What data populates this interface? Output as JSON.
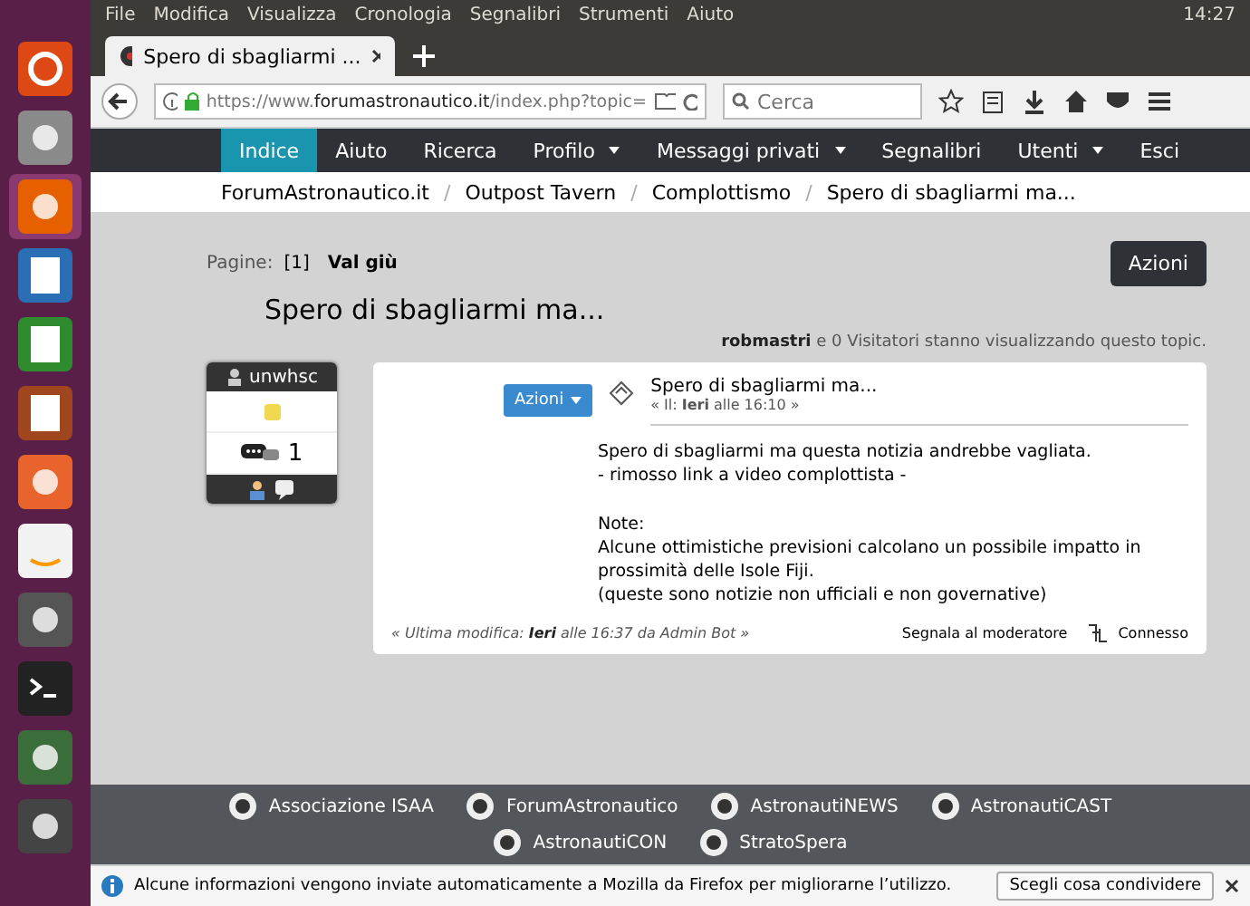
{
  "menu_bar": {
    "items": [
      "File",
      "Modifica",
      "Visualizza",
      "Cronologia",
      "Segnalibri",
      "Strumenti",
      "Aiuto"
    ],
    "clock": "14:27"
  },
  "launcher": {
    "items": [
      {
        "kind": "ubuntu",
        "selected": false
      },
      {
        "kind": "files",
        "selected": false
      },
      {
        "kind": "browser",
        "selected": true
      },
      {
        "kind": "writer",
        "selected": false
      },
      {
        "kind": "calc",
        "selected": false
      },
      {
        "kind": "impress",
        "selected": false
      },
      {
        "kind": "store",
        "selected": false
      },
      {
        "kind": "amazon",
        "selected": false
      },
      {
        "kind": "settings",
        "selected": false
      },
      {
        "kind": "terminal",
        "selected": false
      },
      {
        "kind": "updater",
        "selected": false
      },
      {
        "kind": "floppy",
        "selected": false
      }
    ]
  },
  "tab": {
    "title": "Spero di sbagliarmi ..."
  },
  "address_bar": {
    "url": "https://www.**forumastronautico.it**/index.php?topic="
  },
  "search": {
    "placeholder": "Cerca"
  },
  "forum_nav": [
    {
      "label": "Indice",
      "selected": true,
      "dropdown": false
    },
    {
      "label": "Aiuto",
      "selected": false,
      "dropdown": false
    },
    {
      "label": "Ricerca",
      "selected": false,
      "dropdown": false
    },
    {
      "label": "Profilo",
      "selected": false,
      "dropdown": true
    },
    {
      "label": "Messaggi privati",
      "selected": false,
      "dropdown": true
    },
    {
      "label": "Segnalibri",
      "selected": false,
      "dropdown": false
    },
    {
      "label": "Utenti",
      "selected": false,
      "dropdown": true
    },
    {
      "label": "Esci",
      "selected": false,
      "dropdown": false
    }
  ],
  "breadcrumb_separator": "/",
  "breadcrumbs": [
    "ForumAstronautico.it",
    "Outpost Tavern",
    "Complottismo",
    "Spero di sbagliarmi ma..."
  ],
  "pagination": {
    "label": "Pagine:",
    "current": "[1]",
    "jump": "Val giù"
  },
  "actions_button": "Azioni",
  "topic_title": "Spero di sbagliarmi ma...",
  "viewers": "**robmastri** e 0 Visitatori stanno visualizzando questo topic.",
  "post": {
    "author": {
      "name": "unwhsc",
      "posts": "1"
    },
    "actions_button": "Azioni",
    "title": "Spero di sbagliarmi ma...",
    "date": "« Il: **Ieri** alle 16:10 »",
    "body": [
      [
        "Spero di sbagliarmi ma questa notizia andrebbe vagliata.",
        "- rimosso link a video complottista -"
      ],
      [
        "Note:",
        "Alcune ottimistiche previsioni calcolano un possibile impatto in prossimità delle Isole Fiji.",
        "(queste sono notizie non ufficiali e non governative)"
      ]
    ],
    "edit_note": "« Ultima modifica: **Ieri** alle 16:37 da Admin Bot »",
    "report_link": "Segnala al moderatore",
    "status": "Connesso"
  },
  "footer_links": [
    "Associazione ISAA",
    "ForumAstronautico",
    "AstronautiNEWS",
    "AstronautiCAST",
    "AstronautiCON",
    "StratoSpera"
  ],
  "notification": {
    "text": "Alcune informazioni vengono inviate automaticamente a Mozilla da Firefox per migliorarne l’utilizzo.",
    "button": "Scegli cosa condividere"
  }
}
